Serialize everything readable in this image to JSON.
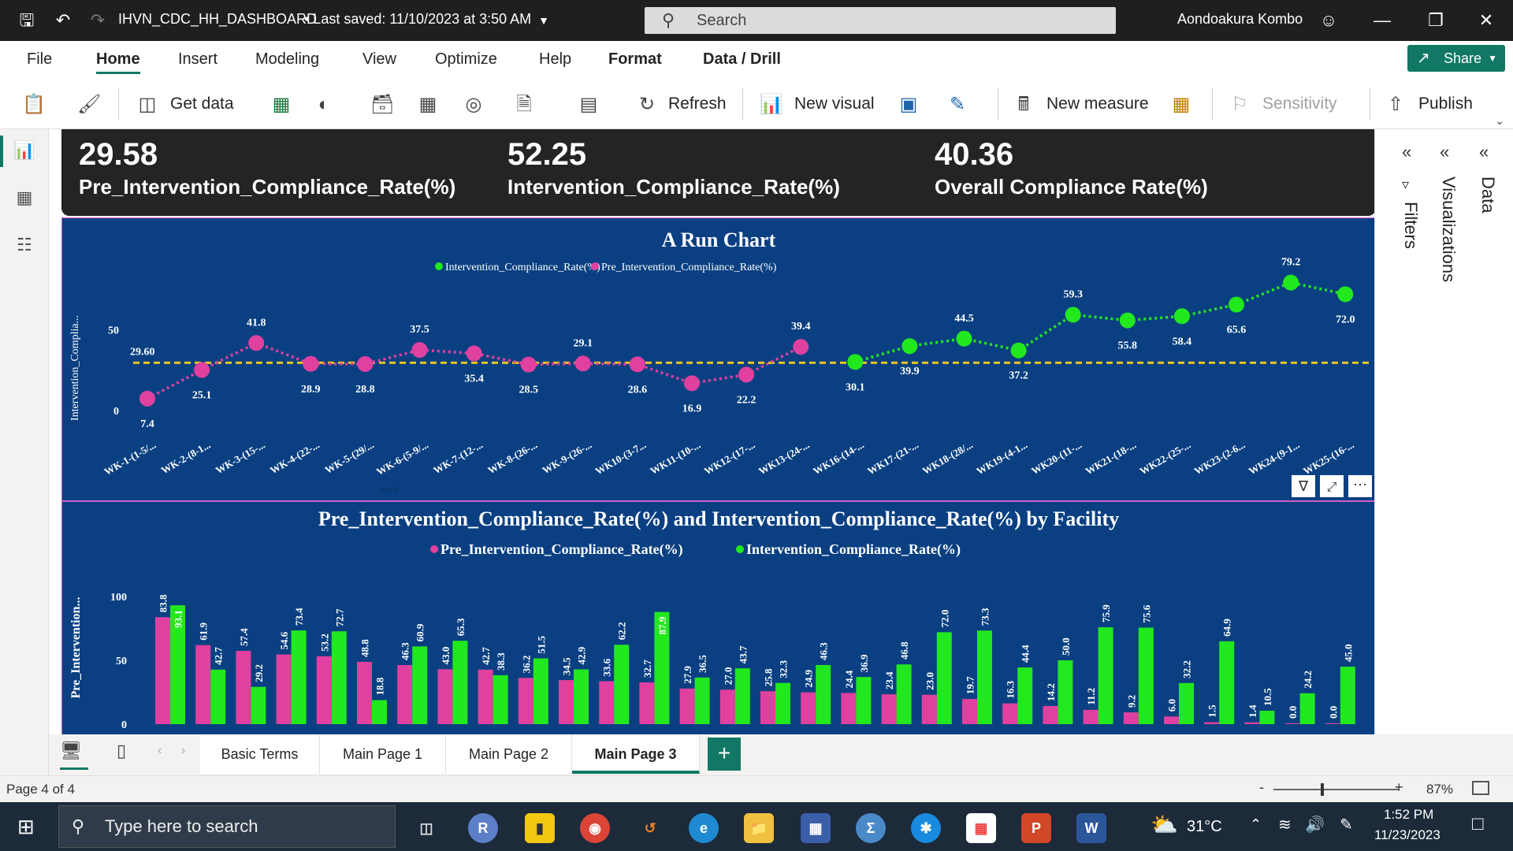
{
  "titlebar": {
    "title": "IHVN_CDC_HH_DASHBOARD",
    "saved": "• Last saved: 11/10/2023 at 3:50 AM",
    "search_placeholder": "Search",
    "user": "Aondoakura Kombo"
  },
  "menu": [
    "File",
    "Home",
    "Insert",
    "Modeling",
    "View",
    "Optimize",
    "Help",
    "Format",
    "Data / Drill"
  ],
  "share_label": "Share",
  "ribbon": {
    "get_data": "Get data",
    "refresh": "Refresh",
    "new_visual": "New visual",
    "new_measure": "New measure",
    "sensitivity": "Sensitivity",
    "publish": "Publish"
  },
  "kpis": [
    {
      "value": "29.58",
      "label": "Pre_Intervention_Compliance_Rate(%)"
    },
    {
      "value": "52.25",
      "label": "Intervention_Compliance_Rate(%)"
    },
    {
      "value": "40.36",
      "label": "Overall Compliance Rate(%)"
    }
  ],
  "run_chart": {
    "title": "A Run Chart",
    "legend": [
      "Intervention_Compliance_Rate(%)",
      "Pre_Intervention_Compliance_Rate(%)"
    ],
    "ylabel": "Intervention_Complia...",
    "xlabel": "week",
    "y_ticks": [
      "0",
      "50"
    ],
    "median_label": "29.60",
    "categories": [
      "WK-1-(1-5/...",
      "WK-2-(8-1...",
      "WK-3-(15-...",
      "WK-4-(22-...",
      "WK-5-(29/...",
      "WK-6-(5-9/...",
      "WK-7-(12-...",
      "WK-8-(26-...",
      "WK-9-(26-...",
      "WK10-(3-7...",
      "WK11-(10-...",
      "WK12-(17-...",
      "WK13-(24-...",
      "WK16-(14-...",
      "WK17-(21-...",
      "WK18-(28/...",
      "WK19-(4-1...",
      "WK20-(11-...",
      "WK21-(18-...",
      "WK22-(25-...",
      "WK23-(2-6...",
      "WK24-(9-1...",
      "WK25-(16-..."
    ]
  },
  "bar_chart": {
    "title": "Pre_Intervention_Compliance_Rate(%) and Intervention_Compliance_Rate(%) by Facility",
    "legend": [
      "Pre_Intervention_Compliance_Rate(%)",
      "Intervention_Compliance_Rate(%)"
    ],
    "ylabel": "Pre_Intervention...",
    "y_ticks": [
      "0",
      "50",
      "100"
    ]
  },
  "chart_data": [
    {
      "type": "line",
      "title": "A Run Chart",
      "xlabel": "week",
      "ylabel": "Intervention_Complia...",
      "ylim": [
        0,
        85
      ],
      "median": 29.6,
      "legend_position": "top",
      "categories": [
        "WK-1-(1-5/...",
        "WK-2-(8-1...",
        "WK-3-(15-...",
        "WK-4-(22-...",
        "WK-5-(29/...",
        "WK-6-(5-9/...",
        "WK-7-(12-...",
        "WK-8-(26-...",
        "WK-9-(26-...",
        "WK10-(3-7...",
        "WK11-(10-...",
        "WK12-(17-...",
        "WK13-(24-...",
        "WK16-(14-...",
        "WK17-(21-...",
        "WK18-(28/...",
        "WK19-(4-1...",
        "WK20-(11-...",
        "WK21-(18-...",
        "WK22-(25-...",
        "WK23-(2-6...",
        "WK24-(9-1...",
        "WK25-(16-..."
      ],
      "series": [
        {
          "name": "Pre_Intervention_Compliance_Rate(%)",
          "color": "#e0409f",
          "values": [
            7.4,
            25.1,
            41.8,
            28.9,
            28.8,
            37.5,
            35.4,
            28.5,
            29.1,
            28.6,
            16.9,
            22.2,
            39.4,
            null,
            null,
            null,
            null,
            null,
            null,
            null,
            null,
            null,
            null
          ]
        },
        {
          "name": "Intervention_Compliance_Rate(%)",
          "color": "#22e81e",
          "values": [
            null,
            null,
            null,
            null,
            null,
            null,
            null,
            null,
            null,
            null,
            null,
            null,
            null,
            30.1,
            39.9,
            44.5,
            37.2,
            59.3,
            55.8,
            58.4,
            65.6,
            79.2,
            72.0
          ]
        }
      ]
    },
    {
      "type": "bar",
      "title": "Pre_Intervention_Compliance_Rate(%) and Intervention_Compliance_Rate(%) by Facility",
      "ylabel": "Pre_Intervention...",
      "ylim": [
        0,
        100
      ],
      "legend_position": "top",
      "series": [
        {
          "name": "Pre_Intervention_Compliance_Rate(%)",
          "color": "#e0409f",
          "values": [
            83.8,
            61.9,
            57.4,
            54.6,
            53.2,
            48.8,
            46.3,
            43.0,
            42.7,
            36.2,
            34.5,
            33.6,
            32.7,
            27.9,
            27.0,
            25.8,
            24.9,
            24.4,
            23.4,
            23.0,
            19.7,
            16.3,
            14.2,
            11.2,
            9.2,
            6.0,
            1.5,
            1.4,
            0.0,
            0.0
          ]
        },
        {
          "name": "Intervention_Compliance_Rate(%)",
          "color": "#22e81e",
          "values": [
            93.1,
            42.7,
            29.2,
            73.4,
            72.7,
            18.8,
            60.9,
            65.3,
            38.3,
            51.5,
            42.9,
            62.2,
            87.9,
            36.5,
            43.7,
            32.3,
            46.3,
            36.9,
            46.8,
            72.0,
            73.3,
            44.4,
            50.0,
            75.9,
            75.6,
            32.2,
            64.9,
            10.5,
            24.2,
            45.0
          ]
        }
      ]
    }
  ],
  "pane": {
    "filters": "Filters",
    "visualizations": "Visualizations",
    "data": "Data"
  },
  "tabs": [
    "Basic Terms",
    "Main Page 1",
    "Main Page 2",
    "Main Page 3"
  ],
  "status": {
    "page": "Page 4 of 4",
    "zoom": "87%"
  },
  "taskbar": {
    "search_placeholder": "Type here to search",
    "temp": "31°C",
    "time": "1:52 PM",
    "date": "11/23/2023"
  }
}
